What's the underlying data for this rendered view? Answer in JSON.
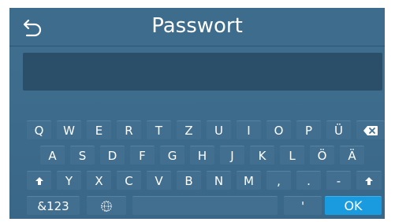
{
  "header": {
    "title": "Passwort",
    "back_icon": "back-arrow-icon"
  },
  "password_field": {
    "value": ""
  },
  "keyboard": {
    "row1": [
      "Q",
      "W",
      "E",
      "R",
      "T",
      "Z",
      "U",
      "I",
      "O",
      "P",
      "Ü"
    ],
    "row2": [
      "A",
      "S",
      "D",
      "F",
      "G",
      "H",
      "J",
      "K",
      "L",
      "Ö",
      "Ä"
    ],
    "row3": [
      "Y",
      "X",
      "C",
      "V",
      "B",
      "N",
      "M",
      ",",
      ".",
      "-"
    ],
    "backspace_icon": "backspace-icon",
    "shift_icon": "shift-up-arrow-icon",
    "symbols_label": "&123",
    "language_icon": "globe-icon",
    "apostrophe_label": "'",
    "ok_label": "OK"
  },
  "colors": {
    "background": "#3f6f8f",
    "key": "#426f8f",
    "field": "#2b4f69",
    "ok_button": "#1a9be0"
  }
}
